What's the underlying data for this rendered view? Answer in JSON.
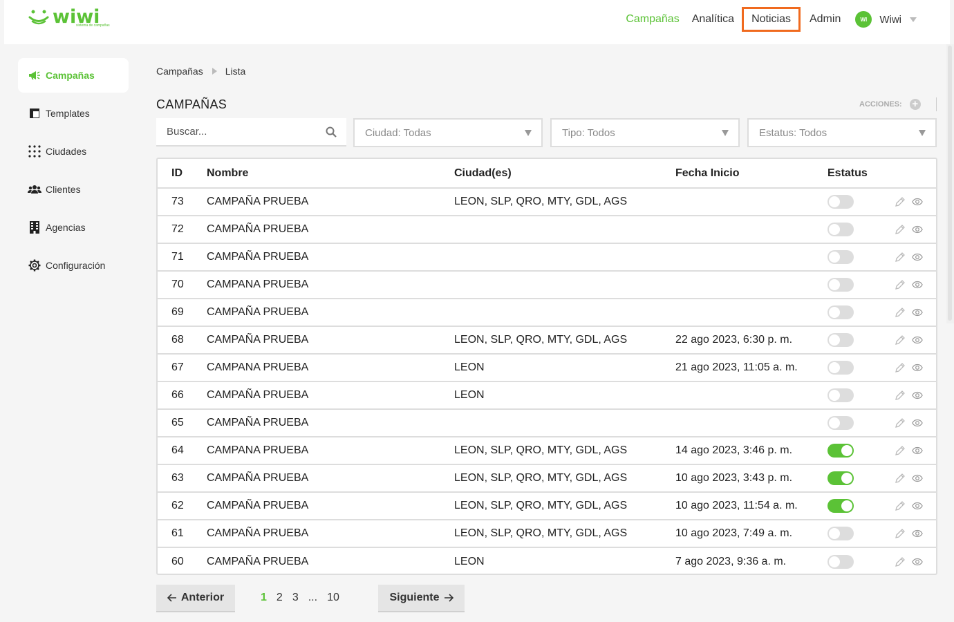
{
  "brand": {
    "name": "wiwi",
    "tagline": "sistema de campañas",
    "color": "#5bc236"
  },
  "nav": {
    "items": [
      {
        "label": "Campañas",
        "active": true
      },
      {
        "label": "Analítica",
        "active": false
      },
      {
        "label": "Noticias",
        "highlighted": true
      },
      {
        "label": "Admin",
        "active": false
      }
    ],
    "user": {
      "initials": "WI",
      "name": "Wiwi"
    }
  },
  "sidebar": {
    "items": [
      {
        "label": "Campañas",
        "icon": "megaphone-icon",
        "active": true
      },
      {
        "label": "Templates",
        "icon": "template-icon"
      },
      {
        "label": "Ciudades",
        "icon": "grid-dots-icon"
      },
      {
        "label": "Clientes",
        "icon": "users-icon"
      },
      {
        "label": "Agencias",
        "icon": "building-icon"
      },
      {
        "label": "Configuración",
        "icon": "gear-icon"
      }
    ]
  },
  "breadcrumb": {
    "root": "Campañas",
    "current": "Lista"
  },
  "page": {
    "title": "CAMPAÑAS",
    "actions_label": "ACCIONES:"
  },
  "filters": {
    "search_placeholder": "Buscar...",
    "city": "Ciudad: Todas",
    "type": "Tipo: Todos",
    "status": "Estatus: Todos"
  },
  "table": {
    "columns": [
      "ID",
      "Nombre",
      "Ciudad(es)",
      "Fecha Inicio",
      "Estatus"
    ],
    "rows": [
      {
        "id": "73",
        "name": "CAMPAÑA PRUEBA",
        "cities": "LEON, SLP, QRO, MTY, GDL, AGS",
        "start": "",
        "active": false
      },
      {
        "id": "72",
        "name": "CAMPAÑA PRUEBA",
        "cities": "",
        "start": "",
        "active": false
      },
      {
        "id": "71",
        "name": "CAMPAÑA PRUEBA",
        "cities": "",
        "start": "",
        "active": false
      },
      {
        "id": "70",
        "name": "CAMPANA PRUEBA",
        "cities": "",
        "start": "",
        "active": false
      },
      {
        "id": "69",
        "name": "CAMPAÑA PRUEBA",
        "cities": "",
        "start": "",
        "active": false
      },
      {
        "id": "68",
        "name": "CAMPAÑA PRUEBA",
        "cities": "LEON, SLP, QRO, MTY, GDL, AGS",
        "start": "22 ago 2023, 6:30 p. m.",
        "active": false
      },
      {
        "id": "67",
        "name": "CAMPANA PRUEBA",
        "cities": "LEON",
        "start": "21 ago 2023, 11:05 a. m.",
        "active": false
      },
      {
        "id": "66",
        "name": "CAMPAÑA PRUEBA",
        "cities": "LEON",
        "start": "",
        "active": false
      },
      {
        "id": "65",
        "name": "CAMPAÑA PRUEBA",
        "cities": "",
        "start": "",
        "active": false
      },
      {
        "id": "64",
        "name": "CAMPANA PRUEBA",
        "cities": "LEON, SLP, QRO, MTY, GDL, AGS",
        "start": "14 ago 2023, 3:46 p. m.",
        "active": true
      },
      {
        "id": "63",
        "name": "CAMPAÑA PRUEBA",
        "cities": "LEON, SLP, QRO, MTY, GDL, AGS",
        "start": "10 ago 2023, 3:43 p. m.",
        "active": true
      },
      {
        "id": "62",
        "name": "CAMPAÑA PRUEBA",
        "cities": "LEON, SLP, QRO, MTY, GDL, AGS",
        "start": "10 ago 2023, 11:54 a. m.",
        "active": true
      },
      {
        "id": "61",
        "name": "CAMPAÑA PRUEBA",
        "cities": "LEON, SLP, QRO, MTY, GDL, AGS",
        "start": "10 ago 2023, 7:49 a. m.",
        "active": false
      },
      {
        "id": "60",
        "name": "CAMPAÑA PRUEBA",
        "cities": "LEON",
        "start": "7 ago 2023, 9:36 a. m.",
        "active": false
      }
    ]
  },
  "pagination": {
    "prev": "Anterior",
    "next": "Siguiente",
    "pages": [
      "1",
      "2",
      "3",
      "...",
      "10"
    ],
    "current": "1"
  }
}
